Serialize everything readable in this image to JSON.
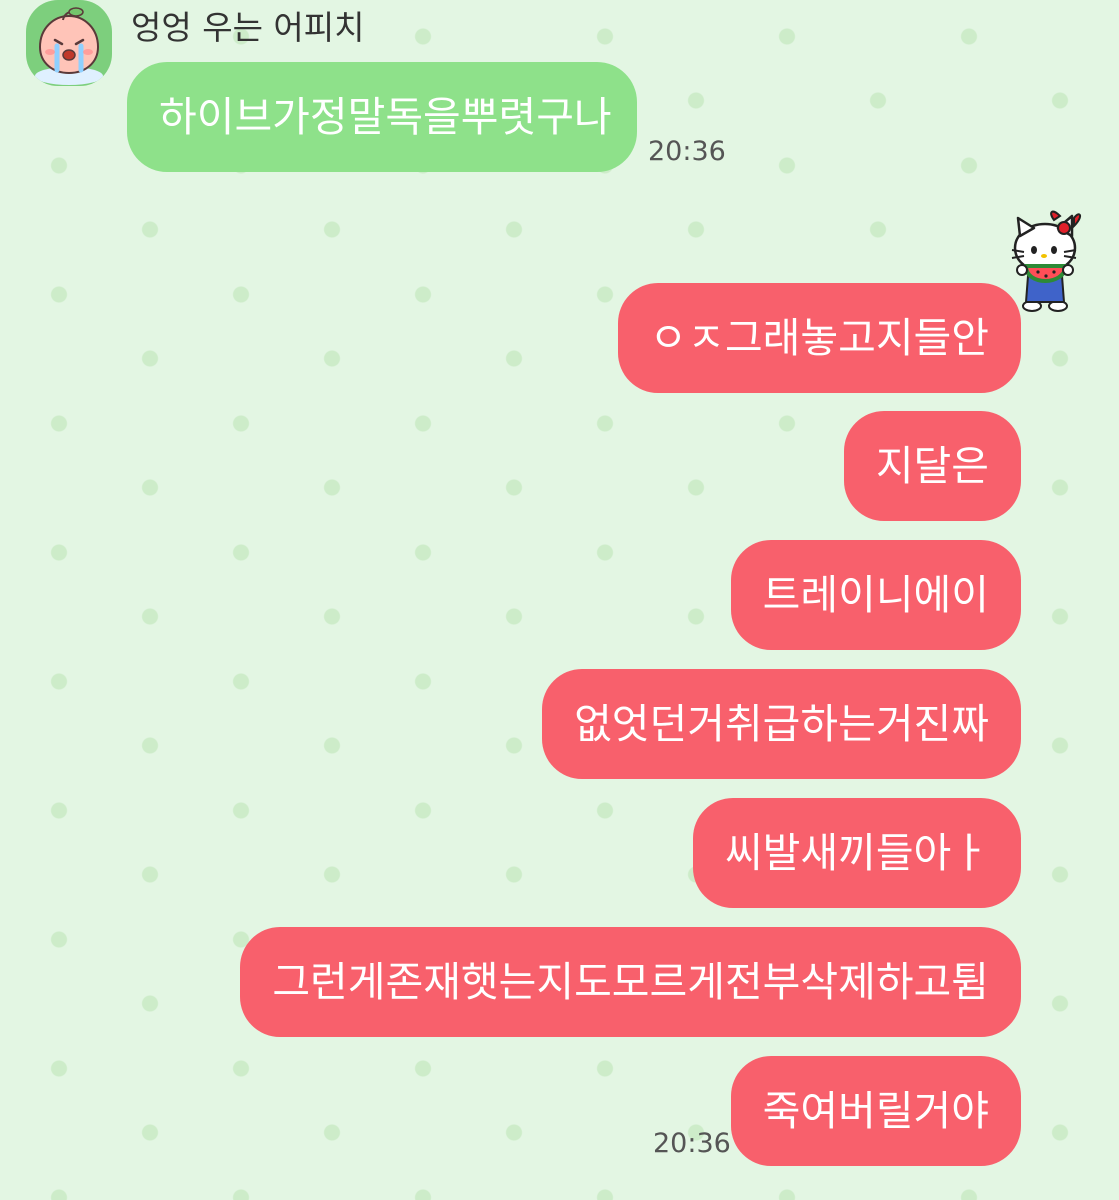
{
  "chat": {
    "sender": {
      "name": "엉엉 우는 어피치",
      "avatar_icon": "crying-apeach-icon"
    },
    "incoming": [
      {
        "text": "하이브가정말독을뿌렷구나"
      }
    ],
    "incoming_time": "20:36",
    "my_avatar_icon": "hello-kitty-watermelon-icon",
    "outgoing": [
      {
        "text": "ㅇㅈ그래놓고지들안"
      },
      {
        "text": "지달은"
      },
      {
        "text": "트레이니에이"
      },
      {
        "text": "없엇던거취급하는거진짜"
      },
      {
        "text": "씨발새끼들아ㅏ"
      },
      {
        "text": "그런게존재햇는지도모르게전부삭제하고튐"
      },
      {
        "text": "죽여버릴거야"
      }
    ],
    "outgoing_time": "20:36"
  },
  "colors": {
    "background": "#e3f6e3",
    "pattern_dot": "#cdecc9",
    "incoming_bubble": "#8ee18a",
    "outgoing_bubble": "#f8606c",
    "text_on_bubble": "#ffffff"
  }
}
